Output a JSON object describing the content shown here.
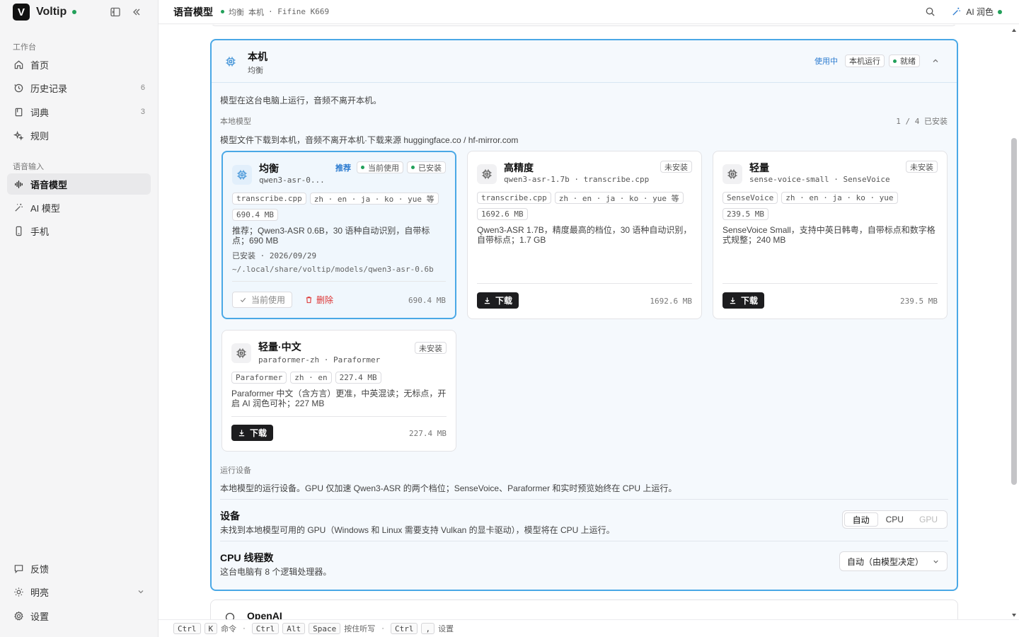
{
  "app": {
    "name": "Voltip",
    "logo_letter": "V",
    "status_color": "#22a05a"
  },
  "sidebar": {
    "section_workspace": "工作台",
    "workspace_items": [
      {
        "label": "首页",
        "icon": "home-icon"
      },
      {
        "label": "历史记录",
        "icon": "history-icon",
        "count": "6"
      },
      {
        "label": "词典",
        "icon": "book-icon",
        "count": "3"
      },
      {
        "label": "规则",
        "icon": "sparkle-icon"
      }
    ],
    "section_voice": "语音输入",
    "voice_items": [
      {
        "label": "语音模型",
        "icon": "waveform-icon",
        "active": true
      },
      {
        "label": "AI 模型",
        "icon": "magic-wand-icon"
      },
      {
        "label": "手机",
        "icon": "phone-icon"
      }
    ],
    "bottom_items": [
      {
        "label": "反馈",
        "icon": "feedback-icon"
      },
      {
        "label": "明亮",
        "icon": "sun-icon"
      },
      {
        "label": "设置",
        "icon": "gear-icon"
      }
    ]
  },
  "topbar": {
    "title": "语音模型",
    "meta_mode": "均衡",
    "meta_local": "本机",
    "meta_device": "· Fifine K669",
    "ai_label": "AI 润色"
  },
  "panel": {
    "title": "本机",
    "subtitle": "均衡",
    "tag_in_use": "使用中",
    "tag_local_run": "本机运行",
    "tag_ready": "就绪",
    "intro": "模型在这台电脑上运行，音频不离开本机。",
    "local_models_label": "本地模型",
    "installed_count": "1 / 4 已安装",
    "download_note": "模型文件下载到本机，音频不离开本机·下载来源 huggingface.co / hf-mirror.com",
    "models": [
      {
        "name": "均衡",
        "id": "qwen3-asr-0...",
        "badge_recommend": "推荐",
        "badge_current": "当前使用",
        "badge_installed": "已安装",
        "pills_row1": [
          "transcribe.cpp",
          "zh · en · ja · ko · yue 等"
        ],
        "pills_row2": [
          "690.4 MB"
        ],
        "desc": "推荐；Qwen3-ASR 0.6B，30 语种自动识别，自带标点；690 MB",
        "installed_date": "已安装 · 2026/09/29",
        "path": "~/.local/share/voltip/models/qwen3-asr-0.6b",
        "current_btn": "当前使用",
        "delete_btn": "删除",
        "size": "690.4 MB"
      },
      {
        "name": "高精度",
        "id": "qwen3-asr-1.7b · transcribe.cpp",
        "status": "未安装",
        "pills_row1": [
          "transcribe.cpp",
          "zh · en · ja · ko · yue 等"
        ],
        "pills_row2": [
          "1692.6 MB"
        ],
        "desc": "Qwen3-ASR 1.7B，精度最高的档位，30 语种自动识别，自带标点；1.7 GB",
        "download_btn": "下载",
        "size": "1692.6 MB"
      },
      {
        "name": "轻量",
        "id": "sense-voice-small · SenseVoice",
        "status": "未安装",
        "pills_row1": [
          "SenseVoice",
          "zh · en · ja · ko · yue"
        ],
        "pills_row2": [
          "239.5 MB"
        ],
        "desc": "SenseVoice Small，支持中英日韩粤，自带标点和数字格式规整；240 MB",
        "download_btn": "下载",
        "size": "239.5 MB"
      },
      {
        "name": "轻量·中文",
        "id": "paraformer-zh · Paraformer",
        "status": "未安装",
        "pills_row1": [
          "Paraformer",
          "zh · en",
          "227.4 MB"
        ],
        "desc": "Paraformer 中文（含方言）更准，中英混读；无标点，开启 AI 润色可补；227 MB",
        "download_btn": "下载",
        "size": "227.4 MB"
      }
    ],
    "run_device_label": "运行设备",
    "run_device_note": "本地模型的运行设备。GPU 仅加速 Qwen3-ASR 的两个档位；SenseVoice、Paraformer 和实时预览始终在 CPU 上运行。",
    "device_title": "设备",
    "device_note": "未找到本地模型可用的 GPU（Windows 和 Linux 需要支持 Vulkan 的显卡驱动），模型将在 CPU 上运行。",
    "device_options": [
      "自动",
      "CPU",
      "GPU"
    ],
    "device_selected": "自动",
    "threads_title": "CPU 线程数",
    "threads_note": "这台电脑有 8 个逻辑处理器。",
    "threads_value": "自动（由模型决定）"
  },
  "next_card": {
    "title": "OpenAI"
  },
  "footer": {
    "k1": "Ctrl",
    "k2": "K",
    "t1": "命令",
    "k3": "Ctrl",
    "k4": "Alt",
    "k5": "Space",
    "t2": "按住听写",
    "k6": "Ctrl",
    "k7": ",",
    "t3": "设置"
  }
}
